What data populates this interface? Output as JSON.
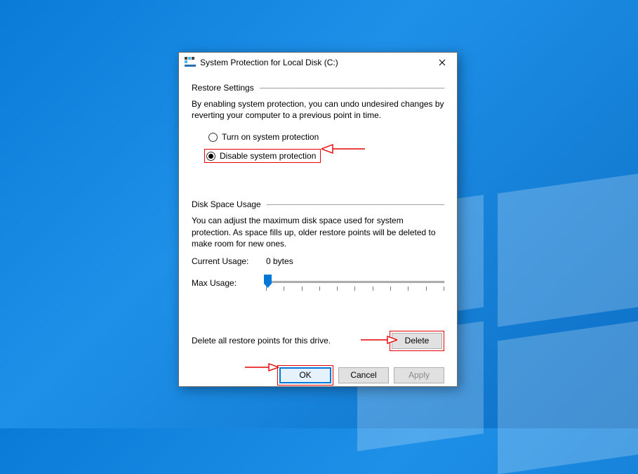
{
  "dialog": {
    "title": "System Protection for Local Disk (C:)"
  },
  "restore": {
    "section_title": "Restore Settings",
    "help": "By enabling system protection, you can undo undesired changes by reverting your computer to a previous point in time.",
    "option_on": "Turn on system protection",
    "option_off": "Disable system protection",
    "selected": "off"
  },
  "disk": {
    "section_title": "Disk Space Usage",
    "help": "You can adjust the maximum disk space used for system protection. As space fills up, older restore points will be deleted to make room for new ones.",
    "current_label": "Current Usage:",
    "current_value": "0 bytes",
    "max_label": "Max Usage:"
  },
  "delete_section": {
    "text": "Delete all restore points for this drive.",
    "button": "Delete"
  },
  "footer": {
    "ok": "OK",
    "cancel": "Cancel",
    "apply": "Apply"
  }
}
